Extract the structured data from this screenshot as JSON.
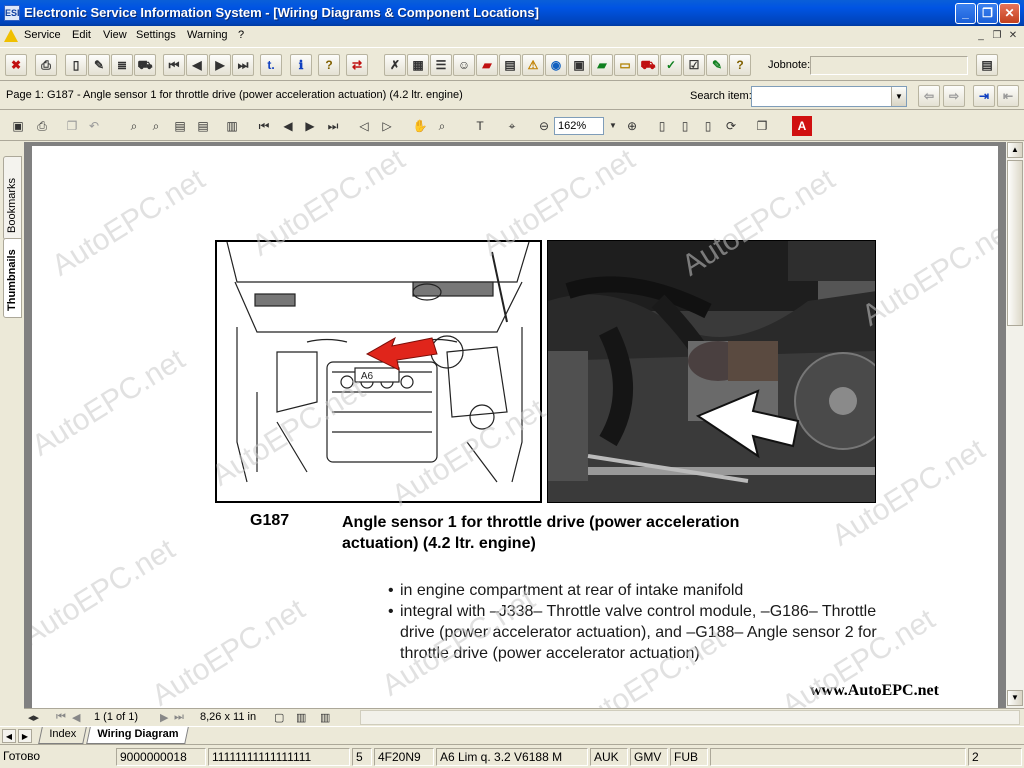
{
  "window": {
    "title": "Electronic Service Information System - [Wiring Diagrams & Component Locations]",
    "app_icon": "esi-app-icon"
  },
  "menu": {
    "items": [
      "Service",
      "Edit",
      "View",
      "Settings",
      "Warning",
      "?"
    ]
  },
  "toolbar": {
    "jobnote_label": "Jobnote:",
    "jobnote_value": ""
  },
  "pagebar": {
    "page_title": "Page 1: G187 - Angle sensor 1 for throttle drive (power acceleration actuation) (4.2 ltr. engine)",
    "search_label": "Search item:",
    "search_value": ""
  },
  "viewer": {
    "zoom": "162%"
  },
  "sidetabs": {
    "bookmarks": "Bookmarks",
    "thumbnails": "Thumbnails"
  },
  "document": {
    "component_code": "G187",
    "component_title": "Angle sensor 1 for throttle drive (power acceleration actuation) (4.2 ltr. engine)",
    "bullets": [
      "in engine compartment at rear of intake manifold",
      "integral with –J338– Throttle valve control module, –G186– Throttle drive (power accelerator actuation), and –G188– Angle sensor 2 for throttle drive (power accelerator actuation)"
    ],
    "website": "www.AutoEPC.net",
    "watermark": "AutoEPC.net"
  },
  "navbar": {
    "page_indicator": "1 (1 of 1)",
    "page_size": "8,26 x 11 in"
  },
  "sheets": {
    "tabs": [
      "Index",
      "Wiring Diagram"
    ],
    "active": "Wiring Diagram"
  },
  "status": {
    "state": "Готово",
    "cells": [
      "9000000018",
      "11111111111111111",
      "5",
      "4F20N9",
      "A6 Lim q. 3.2 V6188 M",
      "AUK",
      "GMV",
      "FUB",
      "",
      "2"
    ]
  },
  "colors": {
    "titlebar": "#0054e3",
    "chrome": "#ece9d8",
    "arrow_red": "#e0251b"
  }
}
